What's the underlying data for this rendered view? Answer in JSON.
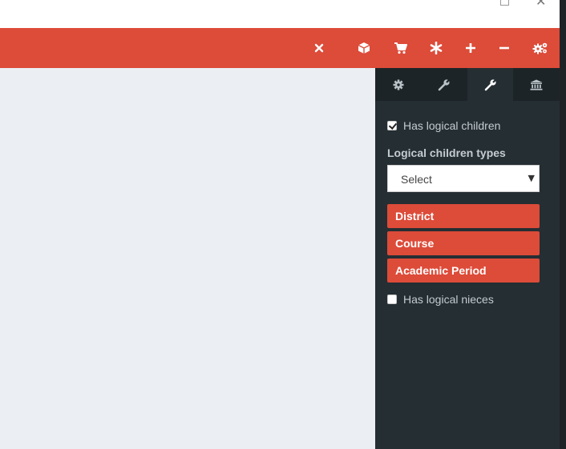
{
  "window": {
    "controls": [
      {
        "name": "maximize-icon"
      },
      {
        "name": "close-icon",
        "glyph": "✕"
      }
    ]
  },
  "toolbar": {
    "color": "#dd4b39",
    "icons": [
      {
        "name": "close-icon"
      },
      {
        "name": "cube-icon"
      },
      {
        "name": "cart-icon"
      },
      {
        "name": "asterisk-icon"
      },
      {
        "name": "plus-icon"
      },
      {
        "name": "minus-icon"
      },
      {
        "name": "gears-icon"
      }
    ]
  },
  "panel": {
    "tabs": [
      {
        "name": "gear-icon",
        "active": false
      },
      {
        "name": "wrench-icon",
        "active": false
      },
      {
        "name": "wrench-icon",
        "active": true
      },
      {
        "name": "bank-icon",
        "active": false
      }
    ],
    "has_logical_children": {
      "label": "Has logical children",
      "checked": true
    },
    "logical_children_types": {
      "title": "Logical children types",
      "select_value": "Select",
      "items": [
        "District",
        "Course",
        "Academic Period"
      ]
    },
    "has_logical_nieces": {
      "label": "Has logical nieces",
      "checked": false
    }
  }
}
